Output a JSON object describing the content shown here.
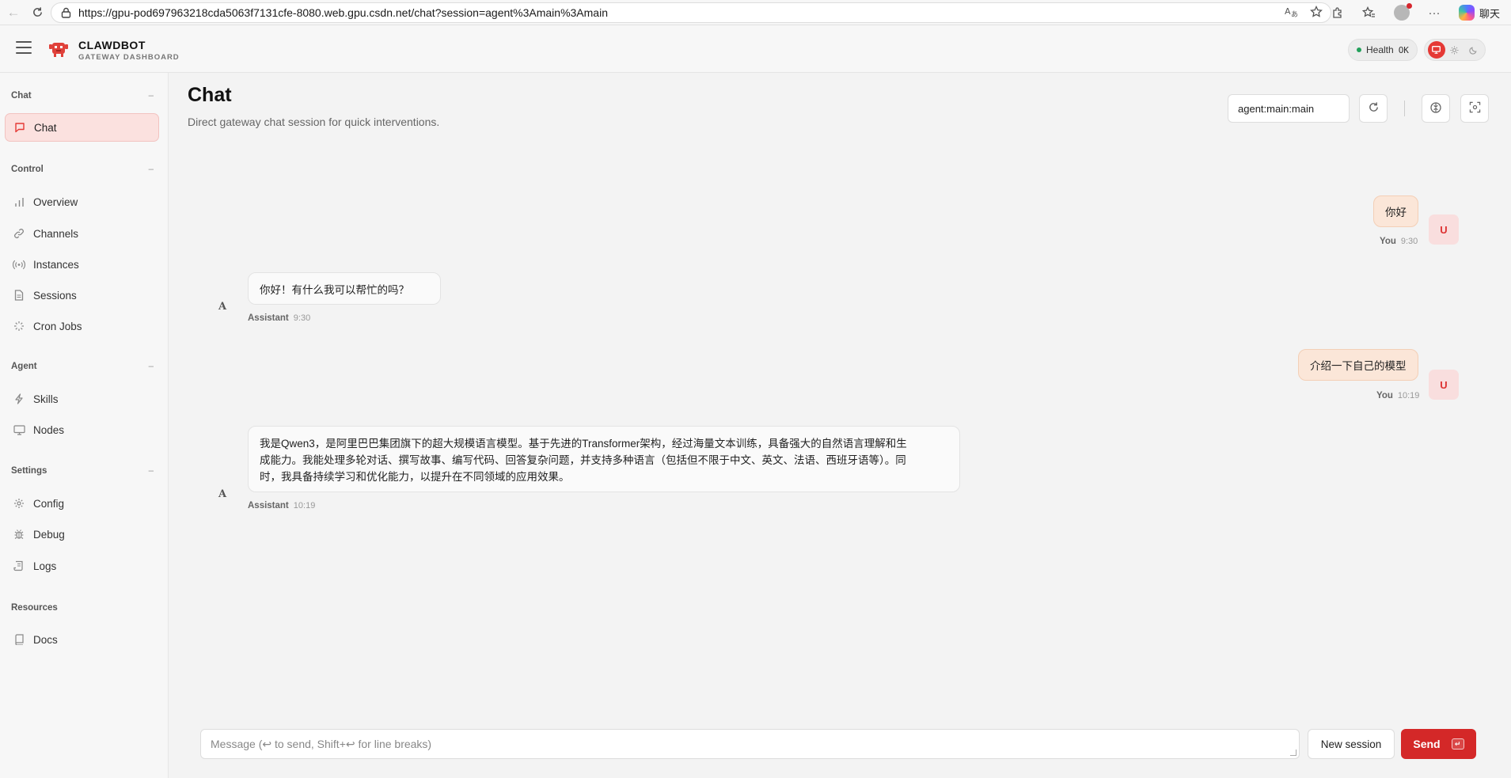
{
  "browser": {
    "url": "https://gpu-pod697963218cda5063f7131cfe-8080.web.gpu.csdn.net/chat?session=agent%3Amain%3Amain",
    "chat_label": "聊天",
    "icons": [
      "back-icon",
      "reload-icon",
      "lock-icon",
      "translate-icon",
      "star-icon",
      "extensions-icon",
      "favorites-icon",
      "profile-icon",
      "more-icon",
      "copilot-icon"
    ]
  },
  "app": {
    "brand_title": "CLAWDBOT",
    "brand_subtitle": "GATEWAY DASHBOARD",
    "health_label": "Health",
    "health_value": "OK",
    "accent_color": "#d42828"
  },
  "sidebar": {
    "sections": [
      {
        "title": "Chat",
        "collapse": "–",
        "items": [
          {
            "label": "Chat",
            "icon": "chat-bubble-icon",
            "active": true
          }
        ]
      },
      {
        "title": "Control",
        "collapse": "–",
        "items": [
          {
            "label": "Overview",
            "icon": "bar-chart-icon"
          },
          {
            "label": "Channels",
            "icon": "link-icon"
          },
          {
            "label": "Instances",
            "icon": "broadcast-icon"
          },
          {
            "label": "Sessions",
            "icon": "document-icon"
          },
          {
            "label": "Cron Jobs",
            "icon": "loader-icon"
          }
        ]
      },
      {
        "title": "Agent",
        "collapse": "–",
        "items": [
          {
            "label": "Skills",
            "icon": "lightning-icon"
          },
          {
            "label": "Nodes",
            "icon": "monitor-icon"
          }
        ]
      },
      {
        "title": "Settings",
        "collapse": "–",
        "items": [
          {
            "label": "Config",
            "icon": "gear-icon"
          },
          {
            "label": "Debug",
            "icon": "bug-icon"
          },
          {
            "label": "Logs",
            "icon": "scroll-icon"
          }
        ]
      },
      {
        "title": "Resources",
        "collapse": "",
        "items": [
          {
            "label": "Docs",
            "icon": "book-icon"
          }
        ]
      }
    ]
  },
  "main": {
    "title": "Chat",
    "subtitle": "Direct gateway chat session for quick interventions.",
    "session_value": "agent:main:main"
  },
  "messages": [
    {
      "role": "user",
      "avatar": "U",
      "author": "You",
      "time": "9:30",
      "text": "你好"
    },
    {
      "role": "assistant",
      "avatar": "A",
      "author": "Assistant",
      "time": "9:30",
      "text": "你好！有什么我可以帮忙的吗？"
    },
    {
      "role": "user",
      "avatar": "U",
      "author": "You",
      "time": "10:19",
      "text": "介绍一下自己的模型"
    },
    {
      "role": "assistant",
      "avatar": "A",
      "author": "Assistant",
      "time": "10:19",
      "lines": [
        "我是Qwen3，是阿里巴巴集团旗下的超大规模语言模型。基于先进的Transformer架构，经过海量文本训练，具备强大的自然语言理解和生",
        "成能力。我能处理多轮对话、撰写故事、编写代码、回答复杂问题，并支持多种语言（包括但不限于中文、英文、法语、西班牙语等）。同",
        "时，我具备持续学习和优化能力，以提升在不同领域的应用效果。"
      ]
    }
  ],
  "composer": {
    "placeholder": "Message (↩ to send, Shift+↩ for line breaks)",
    "value": "",
    "new_session_label": "New session",
    "send_label": "Send",
    "send_kbd": "↵"
  }
}
